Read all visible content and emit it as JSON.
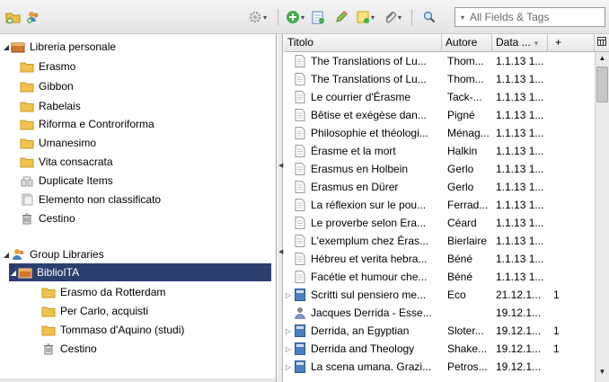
{
  "toolbar": {
    "search_placeholder": "All Fields & Tags"
  },
  "collections": {
    "library": {
      "label": "Libreria personale"
    },
    "items": [
      {
        "label": "Erasmo",
        "icon": "folder-icon"
      },
      {
        "label": "Gibbon",
        "icon": "folder-icon"
      },
      {
        "label": "Rabelais",
        "icon": "folder-icon"
      },
      {
        "label": "Riforma e Controriforma",
        "icon": "folder-icon"
      },
      {
        "label": "Umanesimo",
        "icon": "folder-icon"
      },
      {
        "label": "Vita consacrata",
        "icon": "folder-icon"
      },
      {
        "label": "Duplicate Items",
        "icon": "duplicate-items-icon"
      },
      {
        "label": "Elemento non classificato",
        "icon": "unfiled-items-icon"
      },
      {
        "label": "Cestino",
        "icon": "trash-icon"
      }
    ],
    "group_libraries": {
      "label": "Group Libraries",
      "selected_group": "BiblioITA",
      "children": [
        {
          "label": "Erasmo da Rotterdam",
          "icon": "folder-icon"
        },
        {
          "label": "Per Carlo, acquisti",
          "icon": "folder-icon"
        },
        {
          "label": "Tommaso d'Aquino (studi)",
          "icon": "folder-icon"
        },
        {
          "label": "Cestino",
          "icon": "trash-icon"
        }
      ]
    }
  },
  "items_table": {
    "columns": {
      "title": "Titolo",
      "author": "Autore",
      "date": "Data ...",
      "extra": "+"
    },
    "rows": [
      {
        "title": "The Translations of Lu...",
        "author": "Thom...",
        "date": "1.1.13 1...",
        "notes": "",
        "type": "document",
        "expandable": false
      },
      {
        "title": "The Translations of Lu...",
        "author": "Thom...",
        "date": "1.1.13 1...",
        "notes": "",
        "type": "document",
        "expandable": false
      },
      {
        "title": "Le courrier d'Érasme",
        "author": "Tack-...",
        "date": "1.1.13 1...",
        "notes": "",
        "type": "document",
        "expandable": false
      },
      {
        "title": "Bêtise et exégèse dan...",
        "author": "Pigné",
        "date": "1.1.13 1...",
        "notes": "",
        "type": "document",
        "expandable": false
      },
      {
        "title": "Philosophie et théologi...",
        "author": "Ménag...",
        "date": "1.1.13 1...",
        "notes": "",
        "type": "document",
        "expandable": false
      },
      {
        "title": "Érasme et la mort",
        "author": "Halkin",
        "date": "1.1.13 1...",
        "notes": "",
        "type": "document",
        "expandable": false
      },
      {
        "title": "Erasmus en Holbein",
        "author": "Gerlo",
        "date": "1.1.13 1...",
        "notes": "",
        "type": "document",
        "expandable": false
      },
      {
        "title": "Erasmus en Dürer",
        "author": "Gerlo",
        "date": "1.1.13 1...",
        "notes": "",
        "type": "document",
        "expandable": false
      },
      {
        "title": "La réflexion sur le pou...",
        "author": "Ferrad...",
        "date": "1.1.13 1...",
        "notes": "",
        "type": "document",
        "expandable": false
      },
      {
        "title": "Le proverbe selon Era...",
        "author": "Céard",
        "date": "1.1.13 1...",
        "notes": "",
        "type": "document",
        "expandable": false
      },
      {
        "title": "L'exemplum chez Éras...",
        "author": "Bierlaire",
        "date": "1.1.13 1...",
        "notes": "",
        "type": "document",
        "expandable": false
      },
      {
        "title": "Hébreu et verita hebra...",
        "author": "Béné",
        "date": "1.1.13 1...",
        "notes": "",
        "type": "document",
        "expandable": false
      },
      {
        "title": "Facétie et humour che...",
        "author": "Béné",
        "date": "1.1.13 1...",
        "notes": "",
        "type": "document",
        "expandable": false
      },
      {
        "title": "Scritti sul pensiero me...",
        "author": "Eco",
        "date": "21.12.1...",
        "notes": "1",
        "type": "book",
        "expandable": true
      },
      {
        "title": "Jacques Derrida - Esse...",
        "author": "",
        "date": "19.12.1...",
        "notes": "",
        "type": "person",
        "expandable": false
      },
      {
        "title": "Derrida, an Egyptian",
        "author": "Sloter...",
        "date": "19.12.1...",
        "notes": "1",
        "type": "book",
        "expandable": true
      },
      {
        "title": "Derrida and Theology",
        "author": "Shake...",
        "date": "19.12.1...",
        "notes": "1",
        "type": "book",
        "expandable": true
      },
      {
        "title": "La scena umana. Grazi...",
        "author": "Petros...",
        "date": "19.12.1...",
        "notes": "",
        "type": "book",
        "expandable": true
      }
    ]
  },
  "colors": {
    "selection": "#2c3e6e",
    "folder": "#f2c14e",
    "book": "#4a7fc0"
  }
}
